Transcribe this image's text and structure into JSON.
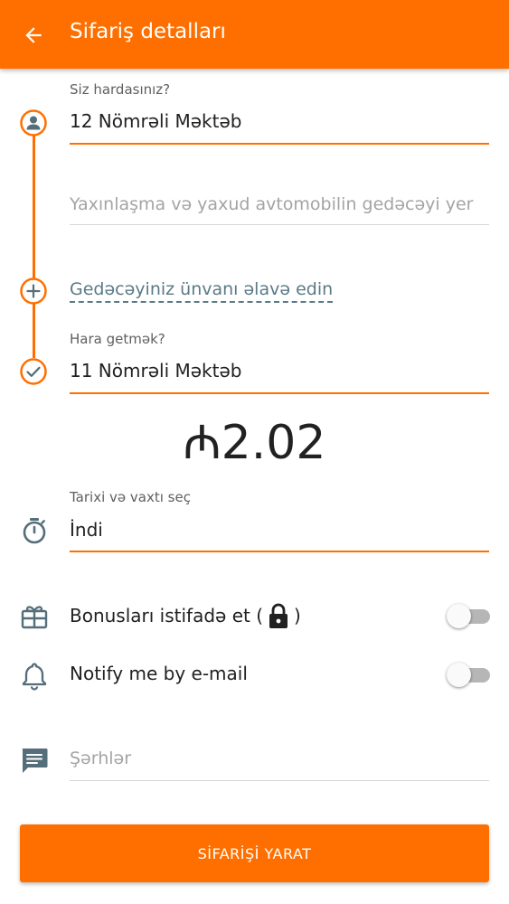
{
  "appbar": {
    "title": "Sifariş detalları",
    "back_icon": "arrow-left-icon"
  },
  "pickup": {
    "label": "Siz hardasınız?",
    "value": "12 Nömrəli Məktəb",
    "icon": "person-icon"
  },
  "approach": {
    "placeholder": "Yaxınlaşma və yaxud avtomobilin gedəcəyi yer"
  },
  "add_stop": {
    "label": "Gedəcəyiniz ünvanı əlavə edin",
    "icon": "plus-circle-icon"
  },
  "destination": {
    "label": "Hara getmək?",
    "value": "11 Nömrəli Məktəb",
    "icon": "check-circle-icon"
  },
  "price": {
    "text": "₼2.02"
  },
  "datetime": {
    "label": "Tarixi və vaxtı seç",
    "value": "İndi",
    "icon": "stopwatch-icon"
  },
  "bonus": {
    "label_prefix": "Bonusları istifadə et (",
    "label_suffix": ")",
    "icon": "gift-box-icon",
    "lock_icon": "lock-icon",
    "enabled": false
  },
  "notify": {
    "label": "Notify me by e-mail",
    "icon": "bell-icon",
    "enabled": false
  },
  "comments": {
    "placeholder": "Şərhlər",
    "icon": "comment-icon"
  },
  "submit": {
    "label": "SİFARİŞİ YARAT"
  },
  "colors": {
    "accent": "#ff6f00",
    "icon_gray": "#546e7a",
    "link": "#5a7a86",
    "placeholder": "#a4a4a4",
    "divider": "#d6d6d6"
  }
}
